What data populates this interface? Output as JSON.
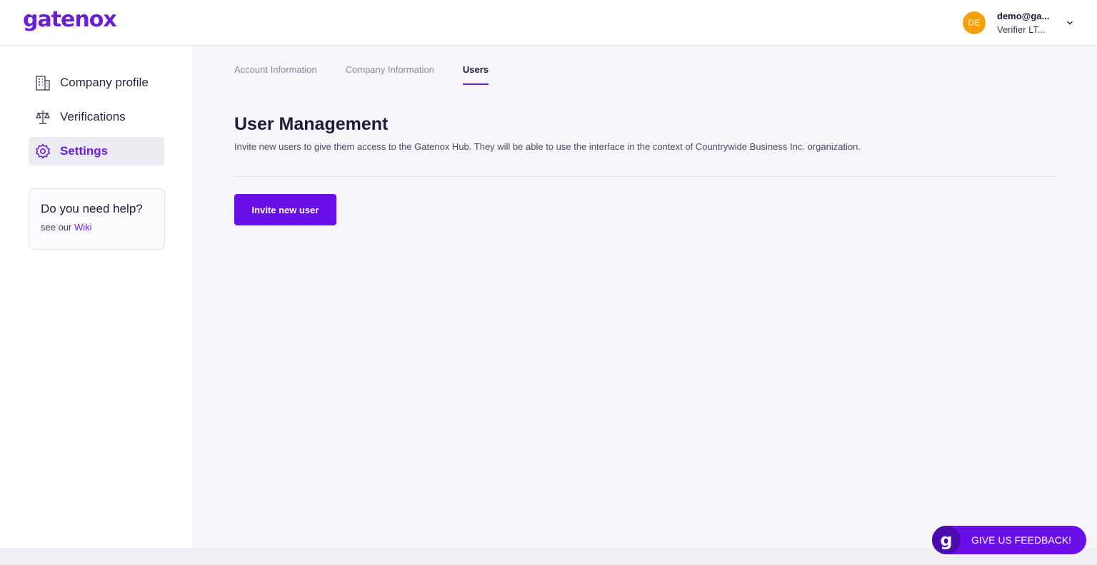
{
  "brand": {
    "logo_text": "gatenox",
    "accent": "#6a0fe8"
  },
  "user": {
    "initials": "DE",
    "email": "demo@ga...",
    "org": "Verifier LT...",
    "avatar_color": "#f5a00b"
  },
  "sidebar": {
    "items": [
      {
        "label": "Company profile",
        "icon": "building-icon",
        "active": false
      },
      {
        "label": "Verifications",
        "icon": "scale-icon",
        "active": false
      },
      {
        "label": "Settings",
        "icon": "gear-icon",
        "active": true
      }
    ],
    "help": {
      "title": "Do you need help?",
      "prefix": "see our",
      "link": "Wiki"
    }
  },
  "tabs": [
    {
      "label": "Account Information",
      "active": false
    },
    {
      "label": "Company Information",
      "active": false
    },
    {
      "label": "Users",
      "active": true
    }
  ],
  "main": {
    "title": "User Management",
    "description": "Invite new users to give them access to the Gatenox Hub. They will be able to use the interface in the context of Countrywide Business Inc. organization.",
    "invite_label": "Invite new user"
  },
  "feedback": {
    "logo_letter": "g",
    "label": "GIVE US FEEDBACK!"
  }
}
